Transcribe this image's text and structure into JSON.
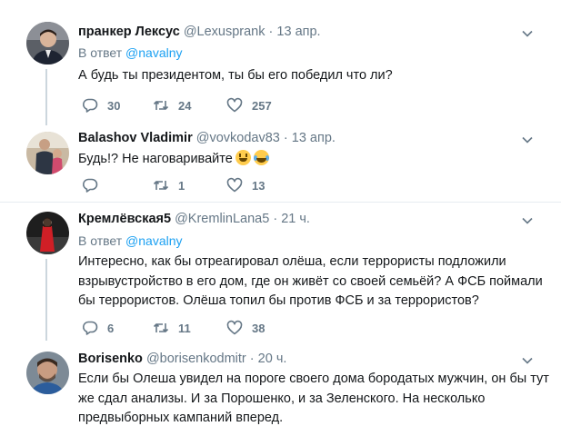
{
  "tweets": [
    {
      "name": "пранкер Лексус",
      "handle": "@Lexusprank",
      "dot": "·",
      "time": "13 апр.",
      "reply_prefix": "В ответ",
      "reply_mention": "@navalny",
      "lines": [
        "А будь ты президентом, ты бы его победил что ли?"
      ],
      "replies": "30",
      "retweets": "24",
      "likes": "257",
      "avatar_color": "#3a3f4a"
    },
    {
      "name": "Balashov Vladimir",
      "handle": "@vovkodav83",
      "dot": "·",
      "time": "13 апр.",
      "lines": [
        "Будь!? Не наговаривайте"
      ],
      "emojis": [
        "grinning-face-emoji",
        "tears-of-joy-emoji"
      ],
      "replies": "",
      "retweets": "1",
      "likes": "13",
      "avatar_color": "#8b7a6a"
    },
    {
      "name": "Кремлёвская5",
      "handle": "@KremlinLana5",
      "dot": "·",
      "time": "21 ч.",
      "reply_prefix": "В ответ",
      "reply_mention": "@navalny",
      "lines": [
        "Интересно, как бы отреагировал олёша, если террористы подложили",
        "взрывустройство в его дом, где он живёт со своей семьёй? А ФСБ поймали",
        "бы террористов. Олёша топил бы против ФСБ и за террористов?"
      ],
      "replies": "6",
      "retweets": "11",
      "likes": "38",
      "avatar_color": "#2b2b2b"
    },
    {
      "name": "Borisenko",
      "handle": "@borisenkodmitr",
      "dot": "·",
      "time": "20 ч.",
      "lines": [
        "Если бы Олеша увидел на пороге своего дома бородатых мужчин, он бы тут",
        "же сдал анализы. И за Порошенко, и за Зеленского. На несколько",
        "предвыборных кампаний вперед."
      ],
      "avatar_color": "#6b7b8c"
    }
  ],
  "colors": {
    "link": "#1da1f2",
    "muted": "#657786",
    "text": "#14171a",
    "divider": "#e6ecf0",
    "thread_line": "#ccd6dd"
  }
}
